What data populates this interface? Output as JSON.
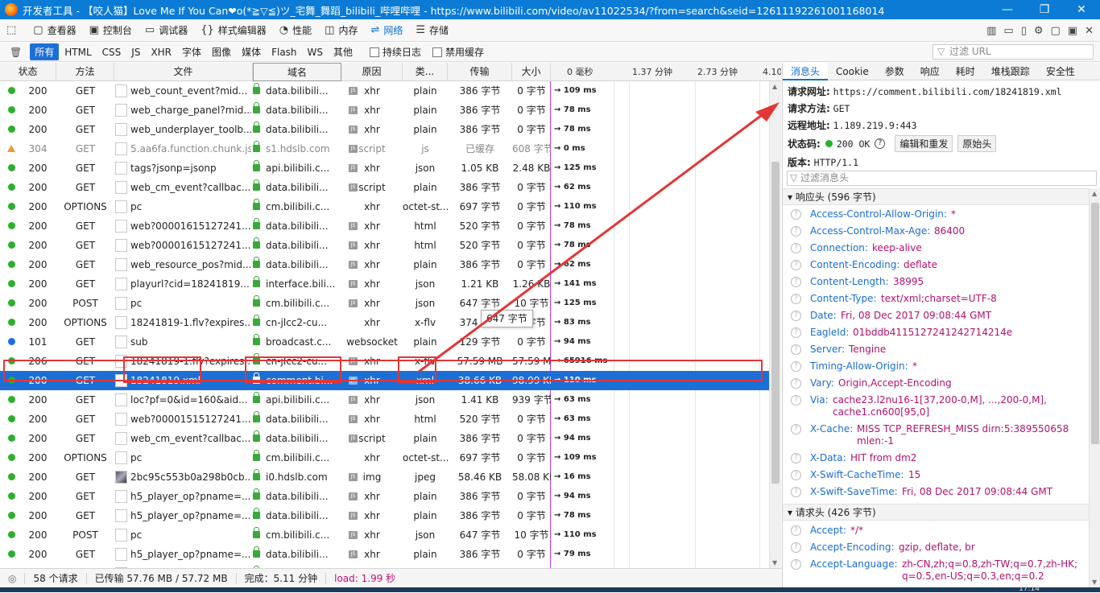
{
  "window": {
    "title": "开发者工具 - 【咬人猫】Love Me If You Can❤o(*≧▽≦)ツ_宅舞_舞蹈_bilibili_哔哩哔哩 - https://www.bilibili.com/video/av11022534/?from=search&seid=12611192261001168014",
    "min": "—",
    "max": "❐",
    "close": "✕"
  },
  "toolbar": {
    "tabs": [
      {
        "label": "查看器",
        "icon": "▢"
      },
      {
        "label": "控制台",
        "icon": "▣"
      },
      {
        "label": "调试器",
        "icon": "▭"
      },
      {
        "label": "样式编辑器",
        "icon": "{}"
      },
      {
        "label": "性能",
        "icon": "◔"
      },
      {
        "label": "内存",
        "icon": "◫"
      },
      {
        "label": "网络",
        "icon": "⇌"
      },
      {
        "label": "存储",
        "icon": "☰"
      }
    ],
    "right_icons": [
      "▥",
      "▭",
      "▯",
      "⚙",
      "▢",
      "▣",
      "✕"
    ]
  },
  "filters": {
    "trash": "🗑",
    "types": [
      "所有",
      "HTML",
      "CSS",
      "JS",
      "XHR",
      "字体",
      "图像",
      "媒体",
      "Flash",
      "WS",
      "其他"
    ],
    "persist_log": "持续日志",
    "disable_cache": "禁用缓存",
    "url_placeholder": "过滤 URL",
    "filter_icon": "▽"
  },
  "columns": {
    "status": "状态",
    "method": "方法",
    "file": "文件",
    "domain": "域名",
    "cause": "原因",
    "type": "类...",
    "transferred": "传输",
    "size": "大小",
    "ticks": [
      "0 毫秒",
      "1.37 分钟",
      "2.73 分钟",
      "4.10"
    ]
  },
  "rows": [
    {
      "dot": "green",
      "status": "200",
      "method": "GET",
      "file": "web_count_event?mid...",
      "lock": true,
      "domain": "data.bilibili...",
      "js": true,
      "cause": "xhr",
      "type": "plain",
      "transferred": "386 字节",
      "size": "0 字节",
      "time": "→ 109 ms"
    },
    {
      "dot": "green",
      "status": "200",
      "method": "GET",
      "file": "web_charge_panel?mid...",
      "lock": true,
      "domain": "data.bilibili...",
      "js": true,
      "cause": "xhr",
      "type": "plain",
      "transferred": "386 字节",
      "size": "0 字节",
      "time": "→ 78 ms"
    },
    {
      "dot": "green",
      "status": "200",
      "method": "GET",
      "file": "web_underplayer_toolb...",
      "lock": true,
      "domain": "data.bilibili...",
      "js": true,
      "cause": "xhr",
      "type": "plain",
      "transferred": "386 字节",
      "size": "0 字节",
      "time": "→ 78 ms"
    },
    {
      "dot": "warn",
      "status": "304",
      "method": "GET",
      "file": "5.aa6fa.function.chunk.js",
      "lock": true,
      "domain": "s1.hdslb.com",
      "js": true,
      "cause": "script",
      "type": "js",
      "transferred": "已缓存",
      "size": "608 字节",
      "time": "→ 0 ms",
      "grey": true
    },
    {
      "dot": "green",
      "status": "200",
      "method": "GET",
      "file": "tags?jsonp=jsonp",
      "lock": true,
      "domain": "api.bilibili.c...",
      "js": true,
      "cause": "xhr",
      "type": "json",
      "transferred": "1.05 KB",
      "size": "2.48 KB",
      "time": "→ 125 ms"
    },
    {
      "dot": "green",
      "status": "200",
      "method": "GET",
      "file": "web_cm_event?callbac...",
      "lock": true,
      "domain": "data.bilibili...",
      "js": true,
      "cause": "script",
      "type": "plain",
      "transferred": "386 字节",
      "size": "0 字节",
      "time": "→ 62 ms"
    },
    {
      "dot": "green",
      "status": "200",
      "method": "OPTIONS",
      "file": "pc",
      "lock": true,
      "domain": "cm.bilibili.c...",
      "js": false,
      "cause": "xhr",
      "type": "octet-st...",
      "transferred": "697 字节",
      "size": "0 字节",
      "time": "→ 110 ms"
    },
    {
      "dot": "green",
      "status": "200",
      "method": "GET",
      "file": "web?00001615127241...",
      "lock": true,
      "domain": "data.bilibili...",
      "js": true,
      "cause": "xhr",
      "type": "html",
      "transferred": "520 字节",
      "size": "0 字节",
      "time": "→ 78 ms"
    },
    {
      "dot": "green",
      "status": "200",
      "method": "GET",
      "file": "web?00001615127241...",
      "lock": true,
      "domain": "data.bilibili...",
      "js": true,
      "cause": "xhr",
      "type": "html",
      "transferred": "520 字节",
      "size": "0 字节",
      "time": "→ 78 ms"
    },
    {
      "dot": "green",
      "status": "200",
      "method": "GET",
      "file": "web_resource_pos?mid...",
      "lock": true,
      "domain": "data.bilibili...",
      "js": true,
      "cause": "xhr",
      "type": "plain",
      "transferred": "386 字节",
      "size": "0 字节",
      "time": "→ 62 ms"
    },
    {
      "dot": "green",
      "status": "200",
      "method": "GET",
      "file": "playurl?cid=18241819...",
      "lock": true,
      "domain": "interface.bili...",
      "js": true,
      "cause": "xhr",
      "type": "json",
      "transferred": "1.21 KB",
      "size": "1.26 KB",
      "time": "→ 141 ms"
    },
    {
      "dot": "green",
      "status": "200",
      "method": "POST",
      "file": "pc",
      "lock": true,
      "domain": "cm.bilibili.c...",
      "js": true,
      "cause": "xhr",
      "type": "json",
      "transferred": "647 字节",
      "size": "10 字节",
      "time": "→ 125 ms"
    },
    {
      "dot": "green",
      "status": "200",
      "method": "OPTIONS",
      "file": "18241819-1.flv?expires...",
      "lock": true,
      "domain": "cn-jlcc2-cu...",
      "js": false,
      "cause": "xhr",
      "type": "x-flv",
      "transferred": "374 字节",
      "size": "0 字节",
      "time": "→ 83 ms"
    },
    {
      "dot": "blue",
      "status": "101",
      "method": "GET",
      "file": "sub",
      "lock": true,
      "domain": "broadcast.c...",
      "js": false,
      "cause": "websocket",
      "type": "plain",
      "transferred": "129 字节",
      "size": "0 字节",
      "time": "→ 94 ms"
    },
    {
      "dot": "green",
      "status": "206",
      "method": "GET",
      "file": "18241819-1.flv?expires...",
      "lock": true,
      "domain": "cn-jlcc2-cu...",
      "js": true,
      "cause": "xhr",
      "type": "x-flv",
      "transferred": "57.59 MB",
      "size": "57.59 MB",
      "time": "→ 65916 ms"
    },
    {
      "dot": "green",
      "status": "200",
      "method": "GET",
      "file": "18241819.xml",
      "lock": true,
      "domain": "comment.bi...",
      "js": true,
      "cause": "xhr",
      "type": "xml",
      "transferred": "38.66 KB",
      "size": "98.99 KB",
      "time": "→ 110 ms",
      "selected": true
    },
    {
      "dot": "green",
      "status": "200",
      "method": "GET",
      "file": "loc?pf=0&id=160&aid...",
      "lock": true,
      "domain": "api.bilibili.c...",
      "js": true,
      "cause": "xhr",
      "type": "json",
      "transferred": "1.41 KB",
      "size": "939 字节",
      "time": "→ 63 ms"
    },
    {
      "dot": "green",
      "status": "200",
      "method": "GET",
      "file": "web?00001515127241...",
      "lock": true,
      "domain": "data.bilibili...",
      "js": true,
      "cause": "xhr",
      "type": "html",
      "transferred": "520 字节",
      "size": "0 字节",
      "time": "→ 63 ms"
    },
    {
      "dot": "green",
      "status": "200",
      "method": "GET",
      "file": "web_cm_event?callbac...",
      "lock": true,
      "domain": "data.bilibili...",
      "js": true,
      "cause": "script",
      "type": "plain",
      "transferred": "386 字节",
      "size": "0 字节",
      "time": "→ 94 ms"
    },
    {
      "dot": "green",
      "status": "200",
      "method": "OPTIONS",
      "file": "pc",
      "lock": true,
      "domain": "cm.bilibili.c...",
      "js": false,
      "cause": "xhr",
      "type": "octet-st...",
      "transferred": "697 字节",
      "size": "0 字节",
      "time": "→ 109 ms"
    },
    {
      "dot": "green",
      "status": "200",
      "method": "GET",
      "file": "2bc95c553b0a298b0cb...",
      "img": true,
      "lock": true,
      "domain": "i0.hdslb.com",
      "js": true,
      "cause": "img",
      "type": "jpeg",
      "transferred": "58.46 KB",
      "size": "58.08 KB",
      "time": "→ 16 ms"
    },
    {
      "dot": "green",
      "status": "200",
      "method": "GET",
      "file": "h5_player_op?pname=...",
      "lock": true,
      "domain": "data.bilibili...",
      "js": true,
      "cause": "xhr",
      "type": "plain",
      "transferred": "386 字节",
      "size": "0 字节",
      "time": "→ 94 ms"
    },
    {
      "dot": "green",
      "status": "200",
      "method": "GET",
      "file": "h5_player_op?pname=...",
      "lock": true,
      "domain": "data.bilibili...",
      "js": true,
      "cause": "xhr",
      "type": "plain",
      "transferred": "386 字节",
      "size": "0 字节",
      "time": "→ 78 ms"
    },
    {
      "dot": "green",
      "status": "200",
      "method": "POST",
      "file": "pc",
      "lock": true,
      "domain": "cm.bilibili.c...",
      "js": true,
      "cause": "xhr",
      "type": "json",
      "transferred": "647 字节",
      "size": "10 字节",
      "time": "→ 110 ms"
    },
    {
      "dot": "green",
      "status": "200",
      "method": "GET",
      "file": "h5_player_op?pname=...",
      "lock": true,
      "domain": "data.bilibili...",
      "js": true,
      "cause": "xhr",
      "type": "plain",
      "transferred": "386 字节",
      "size": "0 字节",
      "time": "→ 79 ms"
    },
    {
      "dot": "green",
      "status": "200",
      "method": "GET",
      "file": "web_cm_event?callbac...",
      "lock": true,
      "domain": "data.bilibili...",
      "js": true,
      "cause": "script",
      "type": "plain",
      "transferred": "386 字节",
      "size": "0 字节",
      "time": "→ 47 ms"
    }
  ],
  "tooltip": "647 字节",
  "status_bar": {
    "requests": "58 个请求",
    "transferred": "已传输 57.76 MB / 57.72 MB",
    "finish": "完成：5.11 分钟",
    "load": "load: 1.99 秒"
  },
  "detail": {
    "tabs": [
      "消息头",
      "Cookie",
      "参数",
      "响应",
      "耗时",
      "堆栈跟踪",
      "安全性"
    ],
    "request_url_label": "请求网址:",
    "request_url": "https://comment.bilibili.com/18241819.xml",
    "request_method_label": "请求方法:",
    "request_method": "GET",
    "remote_label": "远程地址:",
    "remote": "1.189.219.9:443",
    "status_label": "状态码:",
    "status": "200 OK",
    "edit_btn": "编辑和重发",
    "raw_btn": "原始头",
    "version_label": "版本:",
    "version": "HTTP/1.1",
    "filter_placeholder": "过滤消息头",
    "response_section": "响应头 (596 字节)",
    "response_headers": [
      {
        "k": "Access-Control-Allow-Origin:",
        "v": "*"
      },
      {
        "k": "Access-Control-Max-Age:",
        "v": "86400"
      },
      {
        "k": "Connection:",
        "v": "keep-alive"
      },
      {
        "k": "Content-Encoding:",
        "v": "deflate"
      },
      {
        "k": "Content-Length:",
        "v": "38995"
      },
      {
        "k": "Content-Type:",
        "v": "text/xml;charset=UTF-8"
      },
      {
        "k": "Date:",
        "v": "Fri, 08 Dec 2017 09:08:44 GMT"
      },
      {
        "k": "EagleId:",
        "v": "01bddb4115127241242714214e"
      },
      {
        "k": "Server:",
        "v": "Tengine"
      },
      {
        "k": "Timing-Allow-Origin:",
        "v": "*"
      },
      {
        "k": "Vary:",
        "v": "Origin,Accept-Encoding"
      },
      {
        "k": "Via:",
        "v": "cache23.l2nu16-1[37,200-0,M], ...,200-0,M],",
        "v2": "cache1.cn600[95,0]"
      },
      {
        "k": "X-Cache:",
        "v": "MISS TCP_REFRESH_MISS dirn:5:389550658",
        "v2": "mlen:-1"
      },
      {
        "k": "X-Data:",
        "v": "HIT from dm2"
      },
      {
        "k": "X-Swift-CacheTime:",
        "v": "15"
      },
      {
        "k": "X-Swift-SaveTime:",
        "v": "Fri, 08 Dec 2017 09:08:44 GMT"
      }
    ],
    "request_section": "请求头 (426 字节)",
    "request_headers": [
      {
        "k": "Accept:",
        "v": "*/*"
      },
      {
        "k": "Accept-Encoding:",
        "v": "gzip, deflate, br"
      },
      {
        "k": "Accept-Language:",
        "v": "zh-CN,zh;q=0.8,zh-TW;q=0.7,zh-HK;",
        "v2": "q=0.5,en-US;q=0.3,en;q=0.2"
      }
    ]
  },
  "taskbar": {
    "clock": "17:14"
  },
  "colors": {
    "accent": "#1d6fd6",
    "annotation": "#e23636",
    "header_key": "#1a6ccf",
    "header_value": "#b1126d"
  }
}
